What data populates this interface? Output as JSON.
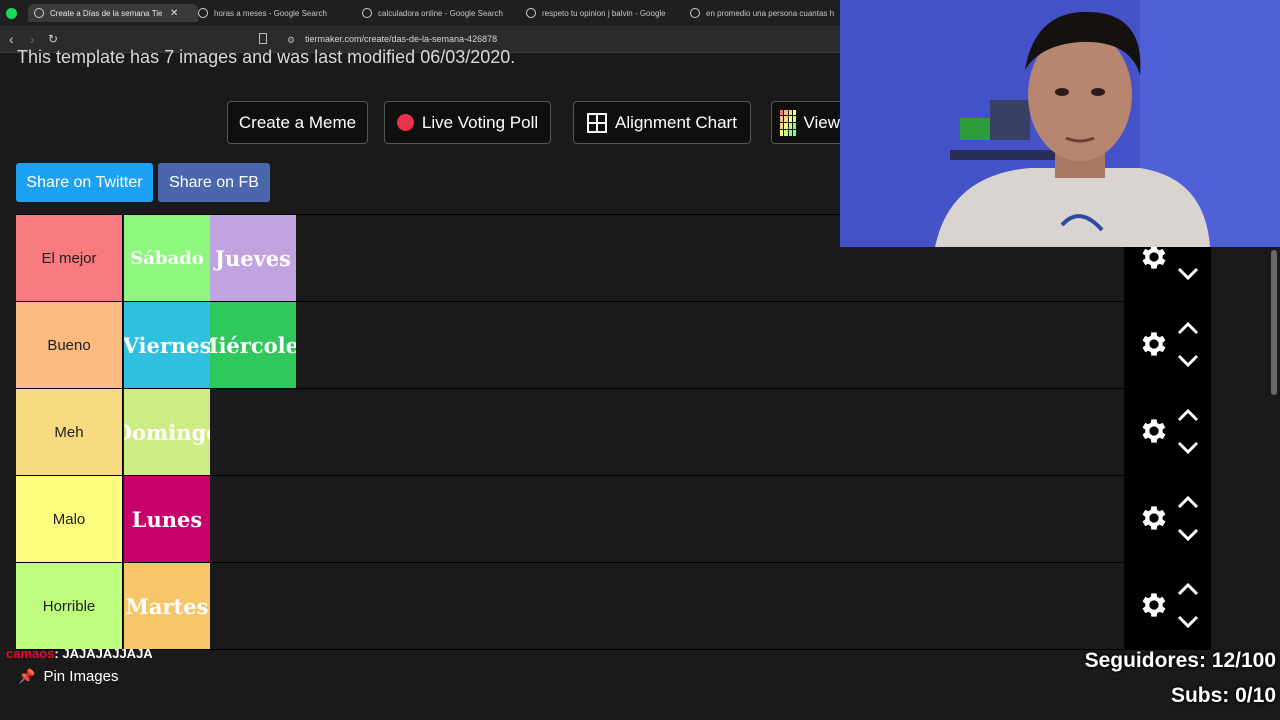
{
  "browser": {
    "tabs": [
      {
        "label": "Create a Días de la semana Tier",
        "active": true
      },
      {
        "label": "horas a meses - Google Search"
      },
      {
        "label": "calculadora online - Google Search"
      },
      {
        "label": "respeto tu opinion j balvin - Google"
      },
      {
        "label": "en promedio una persona cuantas h"
      }
    ],
    "url": "tiermaker.com/create/das-de-la-semana-426878"
  },
  "page": {
    "template_info": "This template has 7 images and was last modified 06/03/2020.",
    "actions": [
      {
        "label": "Create a Meme"
      },
      {
        "label": "Live Voting Poll"
      },
      {
        "label": "Alignment Chart"
      },
      {
        "label": "View"
      }
    ],
    "share": {
      "twitter": "Share on Twitter",
      "fb": "Share on FB"
    },
    "tiers": [
      {
        "label": "El mejor",
        "color": "#f77b7f",
        "items": [
          {
            "text": "Sábado",
            "bg": "#8ff780",
            "size": "18px"
          },
          {
            "text": "Jueves",
            "bg": "#c0a3e0",
            "size": "21px"
          }
        ]
      },
      {
        "label": "Bueno",
        "color": "#f9bb80",
        "items": [
          {
            "text": "Viernes",
            "bg": "#2fc0e0",
            "size": "21px"
          },
          {
            "text": "Miércoles",
            "bg": "#2ec85d",
            "size": "21px"
          }
        ]
      },
      {
        "label": "Meh",
        "color": "#f8da81",
        "items": [
          {
            "text": "Domingo",
            "bg": "#cdec84",
            "size": "21px"
          }
        ]
      },
      {
        "label": "Malo",
        "color": "#fdfe7f",
        "items": [
          {
            "text": "Lunes",
            "bg": "#c8006a",
            "size": "21px"
          }
        ]
      },
      {
        "label": "Horrible",
        "color": "#bffd7f",
        "items": [
          {
            "text": "Martes",
            "bg": "#f7c56a",
            "size": "21px"
          }
        ]
      }
    ],
    "pin_images": "Pin Images"
  },
  "stream": {
    "followers": "Seguidores: 12/100",
    "subs": "Subs: 0/10",
    "chat_user": "camaos",
    "chat_message": ": JAJAJAJJAJA"
  },
  "colors": {
    "twitter": "#1da1f2",
    "facebook": "#4267b2"
  }
}
